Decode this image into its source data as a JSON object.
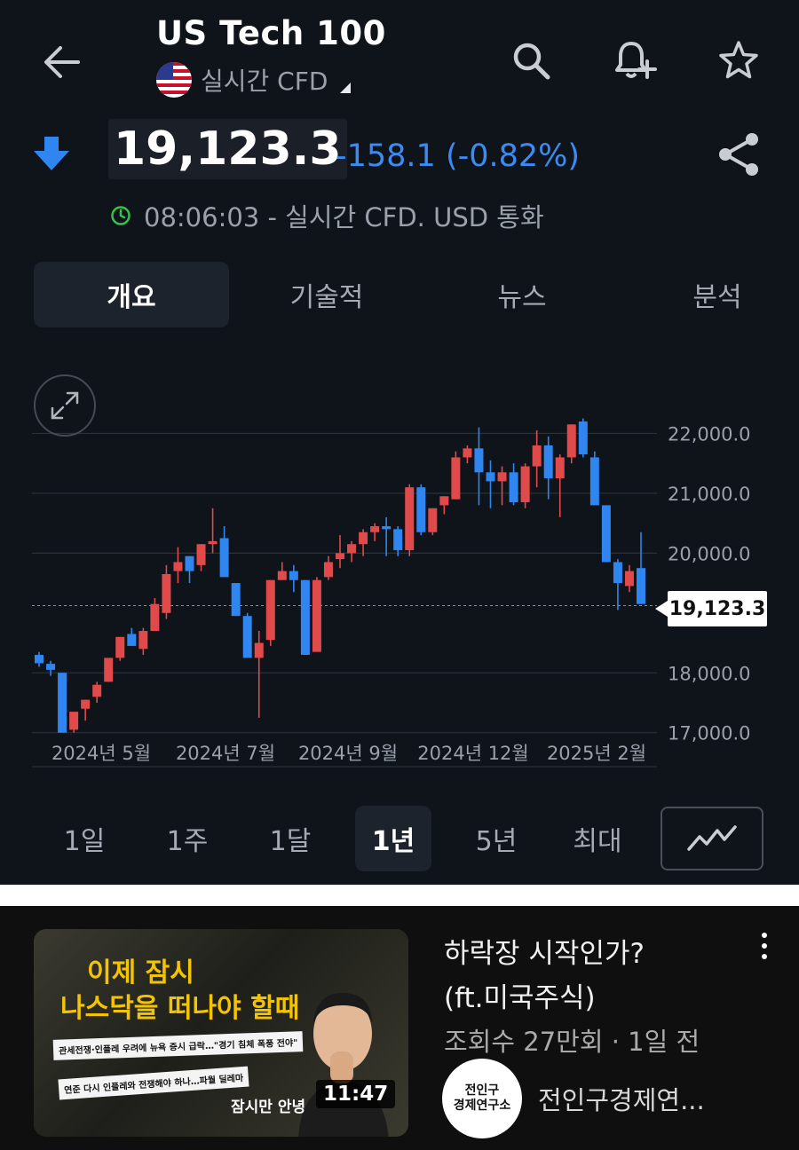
{
  "header": {
    "title": "US Tech 100",
    "subtitle": "실시간 CFD",
    "icons": [
      "back-arrow-icon",
      "search-icon",
      "alert-add-icon",
      "star-icon"
    ]
  },
  "quote": {
    "price": "19,123.3",
    "change": "-158.1 (-0.82%)",
    "direction": "down",
    "time_line": "08:06:03 - 실시간 CFD. USD 통화",
    "colors": {
      "down": "#3b8cf2",
      "up_candle": "#e04a4a",
      "down_candle": "#2f86f0",
      "live_dot": "#35c24a"
    }
  },
  "tabs": [
    {
      "label": "개요",
      "active": true
    },
    {
      "label": "기술적",
      "active": false
    },
    {
      "label": "뉴스",
      "active": false
    },
    {
      "label": "분석",
      "active": false
    }
  ],
  "ranges": [
    {
      "label": "1일",
      "active": false
    },
    {
      "label": "1주",
      "active": false
    },
    {
      "label": "1달",
      "active": false
    },
    {
      "label": "1년",
      "active": true
    },
    {
      "label": "5년",
      "active": false
    },
    {
      "label": "최대",
      "active": false
    }
  ],
  "chart_data": {
    "type": "candlestick",
    "ylim": [
      17000,
      22300
    ],
    "y_ticks": [
      "22,000.0",
      "21,000.0",
      "20,000.0",
      "18,000.0",
      "17,000.0"
    ],
    "y_tick_values": [
      22000,
      21000,
      20000,
      18000,
      17000
    ],
    "x_ticks": [
      "2024년 5월",
      "2024년 7월",
      "2024년 9월",
      "2024년 12월",
      "2025년 2월"
    ],
    "last_price": 19123.3,
    "last_price_label": "19,123.3",
    "grid": true,
    "candles": [
      [
        18300,
        18350,
        18100,
        18160
      ],
      [
        18150,
        18200,
        17950,
        18050
      ],
      [
        18000,
        18000,
        17000,
        17000
      ],
      [
        17050,
        17300,
        17000,
        17350
      ],
      [
        17400,
        17550,
        17200,
        17550
      ],
      [
        17600,
        17850,
        17500,
        17800
      ],
      [
        17850,
        18250,
        17850,
        18250
      ],
      [
        18250,
        18600,
        18200,
        18600
      ],
      [
        18650,
        18750,
        18450,
        18450
      ],
      [
        18400,
        18750,
        18300,
        18700
      ],
      [
        18700,
        19250,
        18700,
        19150
      ],
      [
        19000,
        19800,
        18900,
        19650
      ],
      [
        19700,
        20100,
        19500,
        19850
      ],
      [
        19950,
        19950,
        19500,
        19700
      ],
      [
        19800,
        20150,
        19700,
        20150
      ],
      [
        20150,
        20750,
        20000,
        20200
      ],
      [
        20250,
        20450,
        19600,
        19600
      ],
      [
        19500,
        19500,
        18950,
        18950
      ],
      [
        18950,
        19000,
        18350,
        18250
      ],
      [
        18250,
        18700,
        17250,
        18500
      ],
      [
        18550,
        19550,
        18450,
        19550
      ],
      [
        19550,
        19850,
        19550,
        19700
      ],
      [
        19700,
        19800,
        19350,
        19550
      ],
      [
        19550,
        19550,
        18300,
        18300
      ],
      [
        18350,
        19600,
        18350,
        19550
      ],
      [
        19600,
        19950,
        19550,
        19850
      ],
      [
        19900,
        20300,
        19750,
        20000
      ],
      [
        20000,
        20200,
        19850,
        20150
      ],
      [
        20150,
        20400,
        19950,
        20350
      ],
      [
        20350,
        20500,
        20200,
        20450
      ],
      [
        20450,
        20600,
        19950,
        20400
      ],
      [
        20400,
        20450,
        19950,
        20050
      ],
      [
        20050,
        21150,
        19950,
        21100
      ],
      [
        21100,
        21150,
        20300,
        20350
      ],
      [
        20350,
        20750,
        20300,
        20750
      ],
      [
        20800,
        20950,
        20650,
        20950
      ],
      [
        20900,
        21700,
        20900,
        21600
      ],
      [
        21600,
        21800,
        21500,
        21750
      ],
      [
        21750,
        22100,
        20800,
        21350
      ],
      [
        21350,
        21550,
        20750,
        21200
      ],
      [
        21200,
        21450,
        20800,
        21350
      ],
      [
        21350,
        21500,
        20800,
        20850
      ],
      [
        20850,
        21500,
        20750,
        21450
      ],
      [
        21450,
        22050,
        21100,
        21800
      ],
      [
        21800,
        21950,
        20900,
        21250
      ],
      [
        21250,
        21650,
        20600,
        21600
      ],
      [
        21600,
        22150,
        21500,
        22150
      ],
      [
        22200,
        22250,
        21600,
        21650
      ],
      [
        21600,
        21700,
        20800,
        20800
      ],
      [
        20800,
        20800,
        19850,
        19850
      ],
      [
        19850,
        19900,
        19050,
        19500
      ],
      [
        19450,
        19800,
        19350,
        19700
      ],
      [
        19750,
        20350,
        19150,
        19150
      ]
    ]
  },
  "video": {
    "title_line1": "하락장 시작인가?",
    "title_line2": "(ft.미국주식)",
    "meta": "조회수 27만회 · 1일 전",
    "channel": "전인구경제연...",
    "duration": "11:47",
    "thumb_line1": "이제 잠시",
    "thumb_line2": "나스닥을 떠나야 할때",
    "thumb_news1": "관세전쟁·인플레 우려에 뉴욕 증시 급락…\"경기 침체 폭풍 전야\"",
    "thumb_news2": "연준 다시 인플레와 전쟁해야 하나…파월 딜레마",
    "thumb_caption": "잠시만 안녕",
    "avatar_line1": "전인구",
    "avatar_line2": "경제연구소"
  }
}
